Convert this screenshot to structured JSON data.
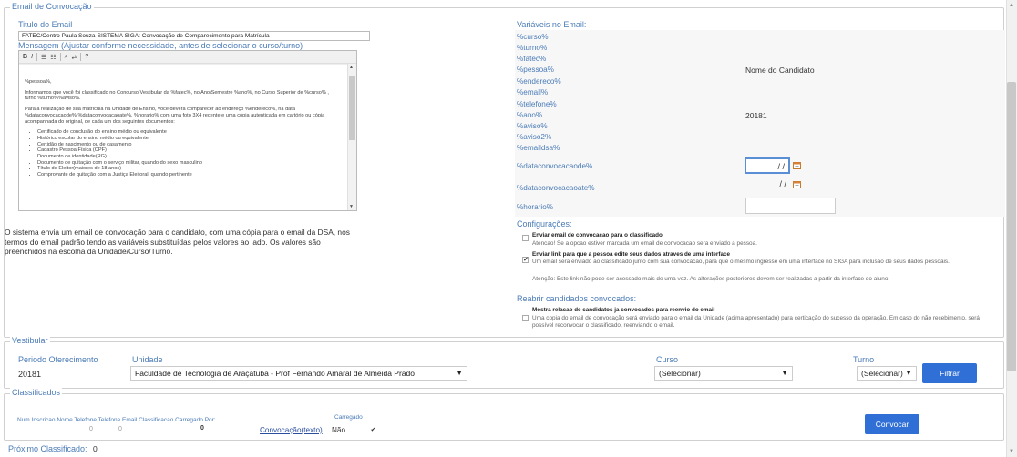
{
  "email_section": {
    "legend": "Email de Convocação",
    "title_label": "Titulo do Email",
    "title_value": "FATEC/Centro Paula Souza-SISTEMA SIGA: Convocação de Comparecimento para Matrícula",
    "message_label": "Mensagem (Ajustar conforme necessidade, antes de selecionar o curso/turno)",
    "toolbar": {
      "bold": "B",
      "italic": "I"
    },
    "body": {
      "greeting": "%pessoa%,",
      "p1": "Informamos que você foi classificado no Concurso Vestibular da %fatec%, no Ano/Semestre %ano%, no Curso Superior de %curso% , turno %turno%%aviso%.",
      "p2": "Para a realização de sua matrícula na Unidade de Ensino, você deverá comparecer ao endereço %endereco%, na data %dataconvocacaode% %dataconvocacaoate%, %horario% com uma foto 3X4 recente e uma cópia autenticada em cartório ou cópia acompanhada do original, de cada um dos seguintes documentos:",
      "docs": [
        "Certificado de conclusão do ensino médio ou equivalente",
        "Histórico escolar do ensino médio ou equivalente",
        "Certidão de nascimento ou de casamento",
        "Cadastro Pessoa Física (CPF)",
        "Documento de identidade(RG)",
        "Documento de quitação com o serviço militar, quando do sexo masculino",
        "Título de Eleitor(maiores de 18 anos)",
        "Comprovante de quitação com a Justiça Eleitoral, quando pertinente"
      ]
    },
    "description": "O sistema envia um email de convocação para o candidato, com uma cópia para o email da DSA, nos termos do email padrão tendo as variáveis substituídas pelos valores ao lado. Os valores são preenchidos na escolha da Unidade/Curso/Turno."
  },
  "variables": {
    "label": "Variáveis no Email:",
    "items": [
      "%curso%",
      "%turno%",
      "%fatec%",
      "%pessoa%",
      "%endereco%",
      "%email%",
      "%telefone%",
      "%ano%",
      "%aviso%",
      "%aviso2%",
      "%emaildsa%"
    ],
    "pessoa_value": "Nome do Candidato",
    "ano_value": "20181",
    "data_de_label": "%dataconvocacaode%",
    "data_de_value": "/ /",
    "data_ate_label": "%dataconvocacaoate%",
    "data_ate_value": "/ /",
    "horario_label": "%horario%"
  },
  "config": {
    "label": "Configurações:",
    "opt1_title": "Enviar email de convocacao para o classificado",
    "opt1_text": "Atencao! Se a opcao estiver marcada um email de convocacao sera enviado a pessoa.",
    "opt2_title": "Enviar link para que a pessoa edite seus dados atraves de uma interface",
    "opt2_text": "Um email sera enviado ao classificado junto com sua convocacao, para que o mesmo ingresse em uma interface no SIGA para inclusao de seus dados pessoais.",
    "opt2_text2": "Atenção: Este link não pode ser acessado mais de uma vez. As alterações posteriores devem ser realizadas a partir da interface do aluno.",
    "reopen_label": "Reabrir candidados convocados:",
    "opt3_title": "Mostra relacao de candidatos ja convocados para reenvio do email",
    "opt3_text": "Uma copia do email de convocação será enviado para o email da Unidade (acima apresentado) para certicação do sucesso da operação.  Em caso do não recebimento, será possível reconvocar o classificado, reenviando o email."
  },
  "vestibular": {
    "legend": "Vestibular",
    "periodo_label": "Periodo Oferecimento",
    "periodo_value": "20181",
    "unidade_label": "Unidade",
    "unidade_value": "Faculdade de Tecnologia de Araçatuba - Prof Fernando Amaral de Almeida Prado",
    "curso_label": "Curso",
    "curso_value": "(Selecionar)",
    "turno_label": "Turno",
    "turno_value": "(Selecionar)",
    "filter_button": "Filtrar"
  },
  "classificados": {
    "legend": "Classificados",
    "headers": "Num Inscricao Nome Telefone Telefone Email Classificacao Carregado Por:",
    "carregado_label": "Carregado",
    "zero1": "0",
    "zero2": "0",
    "zero3": "0",
    "convocacao_link": "Convocação(texto)",
    "nao_value": "Não",
    "convocar_button": "Convocar"
  },
  "proximo": {
    "label": "Próximo Classificado:",
    "value": "0"
  }
}
